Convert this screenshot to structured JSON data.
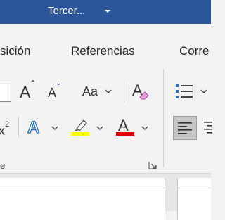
{
  "titlebar": {
    "title": "Tercer...",
    "bg_color": "#2b579a"
  },
  "tabs": [
    {
      "label": "sición"
    },
    {
      "label": "Referencias"
    },
    {
      "label": "Corre"
    }
  ],
  "font_group": {
    "label": "e",
    "grow_font_glyph": "A",
    "grow_font_arrow": "ˆ",
    "shrink_font_glyph": "A",
    "shrink_font_arrow": "ˇ",
    "change_case_label": "Aa",
    "clear_format_glyph": "A",
    "superscript_glyph": "x",
    "superscript_mark": "2",
    "text_effects_glyph": "A",
    "font_color_glyph": "A",
    "highlight_color": "#ffff00",
    "font_color": "#e00000",
    "text_effects_color": "#1f6fc5"
  },
  "icons": {
    "title_caret": "chevron-down-icon",
    "bullets": "bullet-list-icon",
    "align_left": "align-left-icon",
    "align_center": "align-center-icon",
    "launcher": "dialog-launcher-icon",
    "highlighter": "highlighter-icon",
    "eraser": "eraser-icon"
  }
}
